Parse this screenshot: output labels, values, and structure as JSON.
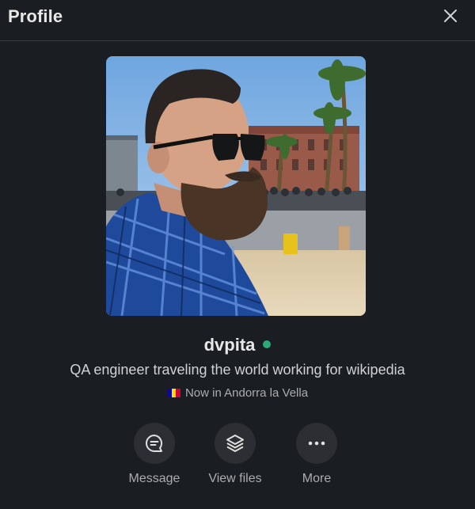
{
  "header": {
    "title": "Profile",
    "close_icon": "close-icon"
  },
  "profile": {
    "photo_alt": "Profile photo",
    "name": "dvpita",
    "status": "active",
    "status_color": "#2bac76",
    "bio": "QA engineer traveling the world working for wikipedia",
    "location": "Now in Andorra la Vella",
    "flag_icon": "andorra-flag-icon"
  },
  "actions": [
    {
      "label": "Message",
      "icon": "message-icon"
    },
    {
      "label": "View files",
      "icon": "layers-icon"
    },
    {
      "label": "More",
      "icon": "more-icon"
    }
  ],
  "colors": {
    "background": "#1a1d21",
    "action_circle": "#2c2e33",
    "divider": "#3b3d41"
  }
}
